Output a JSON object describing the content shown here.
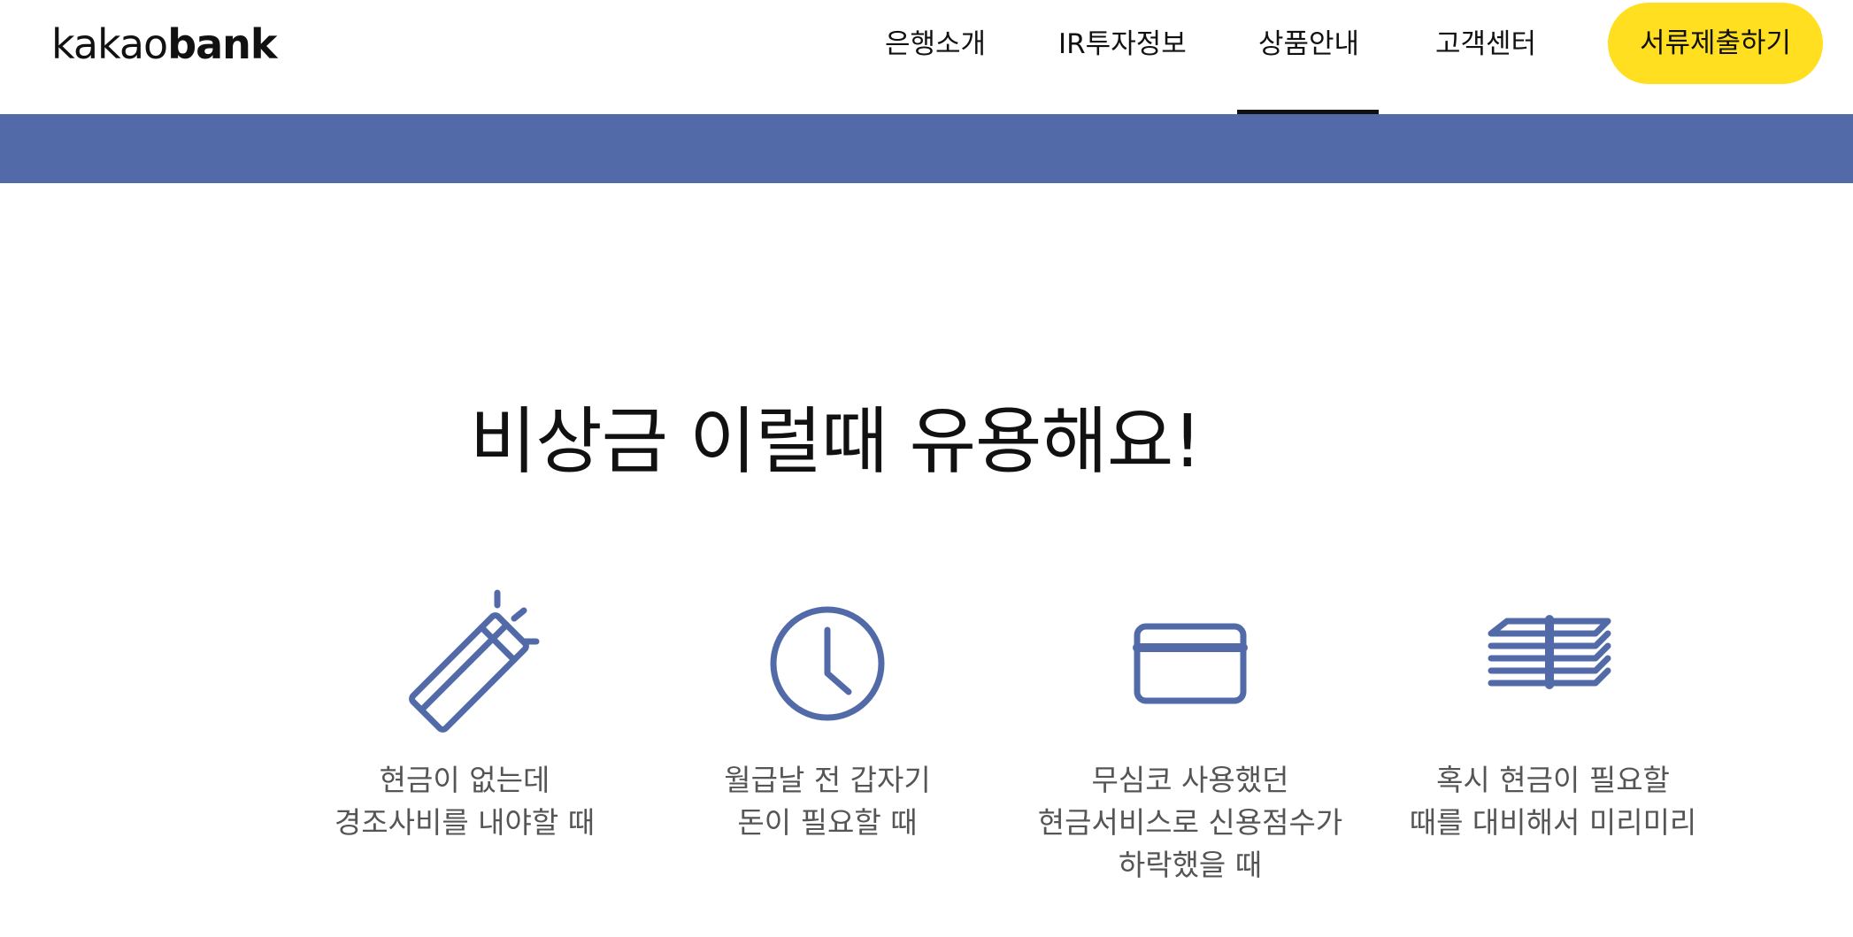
{
  "header": {
    "logo": {
      "light": "kakao",
      "bold": "bank"
    },
    "nav": [
      {
        "label": "은행소개"
      },
      {
        "label": "IR투자정보"
      },
      {
        "label": "상품안내",
        "active": true
      },
      {
        "label": "고객센터"
      }
    ],
    "cta_label": "서류제출하기"
  },
  "main": {
    "headline": "비상금 이럴때 유용해요!",
    "cases": [
      {
        "icon": "envelope-sparkle-icon",
        "lines": [
          "현금이 없는데",
          "경조사비를 내야할 때"
        ]
      },
      {
        "icon": "clock-icon",
        "lines": [
          "월급날 전 갑자기",
          "돈이 필요할 때"
        ]
      },
      {
        "icon": "credit-card-icon",
        "lines": [
          "무심코 사용했던",
          "현금서비스로 신용점수가",
          "하락했을 때"
        ]
      },
      {
        "icon": "cash-stack-icon",
        "lines": [
          "혹시 현금이 필요할",
          "때를 대비해서 미리미리"
        ]
      }
    ]
  },
  "colors": {
    "accent_blue": "#526ba8",
    "cta_yellow": "#ffdf1f",
    "text_dark": "#111111",
    "text_gray": "#555555"
  }
}
